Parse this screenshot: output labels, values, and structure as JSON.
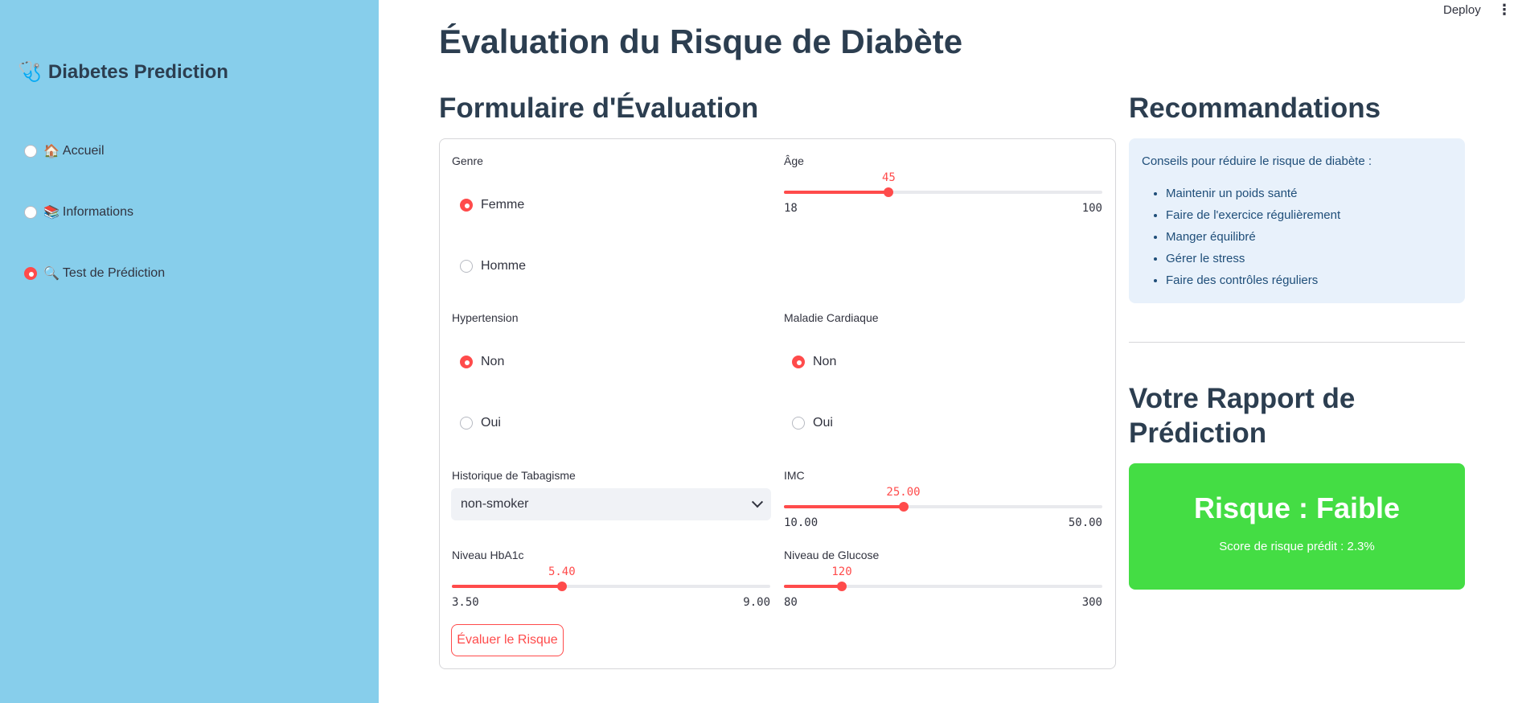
{
  "sidebar": {
    "brand_icon": "🩺",
    "brand_title": "Diabetes Prediction",
    "items": [
      {
        "emoji": "🏠",
        "label": "Accueil",
        "selected": false
      },
      {
        "emoji": "📚",
        "label": "Informations",
        "selected": false
      },
      {
        "emoji": "🔍",
        "label": "Test de Prédiction",
        "selected": true
      }
    ]
  },
  "toolbar": {
    "deploy_label": "Deploy",
    "menu_glyph": "⋮"
  },
  "page_title": "Évaluation du Risque de Diabète",
  "form": {
    "heading": "Formulaire d'Évaluation",
    "genre": {
      "label": "Genre",
      "options": [
        "Femme",
        "Homme"
      ],
      "selected": "Femme"
    },
    "age": {
      "label": "Âge",
      "value": "45",
      "min": "18",
      "max": "100",
      "fraction": 0.3293
    },
    "hypertension": {
      "label": "Hypertension",
      "options": [
        "Non",
        "Oui"
      ],
      "selected": "Non"
    },
    "maladie_cardiaque": {
      "label": "Maladie Cardiaque",
      "options": [
        "Non",
        "Oui"
      ],
      "selected": "Non"
    },
    "tabagisme": {
      "label": "Historique de Tabagisme",
      "value": "non-smoker"
    },
    "imc": {
      "label": "IMC",
      "value": "25.00",
      "min": "10.00",
      "max": "50.00",
      "fraction": 0.375
    },
    "hba1c": {
      "label": "Niveau HbA1c",
      "value": "5.40",
      "min": "3.50",
      "max": "9.00",
      "fraction": 0.3455
    },
    "glucose": {
      "label": "Niveau de Glucose",
      "value": "120",
      "min": "80",
      "max": "300",
      "fraction": 0.1818
    },
    "submit_label": "Évaluer le Risque"
  },
  "recommendations": {
    "heading": "Recommandations",
    "intro": "Conseils pour réduire le risque de diabète :",
    "items": [
      "Maintenir un poids santé",
      "Faire de l'exercice régulièrement",
      "Manger équilibré",
      "Gérer le stress",
      "Faire des contrôles réguliers"
    ]
  },
  "report": {
    "heading": "Votre Rapport de Prédiction",
    "risk_title": "Risque : Faible",
    "risk_score": "Score de risque prédit : 2.3%",
    "risk_color": "#44dd44"
  },
  "colors": {
    "accent": "#ff4b4b",
    "sidebar_bg": "#87ceeb",
    "heading": "#2c3e50"
  }
}
